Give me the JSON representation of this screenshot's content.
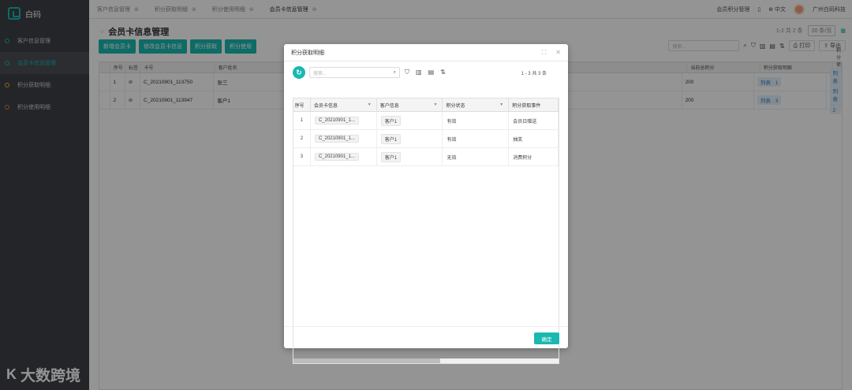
{
  "app": {
    "name": "白码",
    "brand_color": "#19b8b0"
  },
  "sidebar": {
    "items": [
      {
        "label": "客户信息管理"
      },
      {
        "label": "会员卡信息管理"
      },
      {
        "label": "积分获取明细"
      },
      {
        "label": "积分使用明细"
      }
    ]
  },
  "watermark": {
    "mark": "K",
    "text": "大数跨境"
  },
  "tabs": [
    {
      "label": "客户信息管理"
    },
    {
      "label": "积分获取明细"
    },
    {
      "label": "积分使用明细"
    },
    {
      "label": "会员卡信息管理"
    }
  ],
  "topbar": {
    "module": "会员积分管理",
    "lang": "中文",
    "org": "广州白码科技"
  },
  "page": {
    "title": "会员卡信息管理",
    "pager": "1-2 共 2 条",
    "page_size": "20 条/页",
    "buttons": [
      "新增会员卡",
      "修改会员卡信息",
      "积分获取",
      "积分使用"
    ],
    "search_placeholder": "搜索...",
    "print_label": "打印",
    "export_label": "导出"
  },
  "grid": {
    "columns": [
      "序号",
      "标签",
      "卡号",
      "客户姓名",
      "当前总积分",
      "积分获取明细",
      "积分使用明细"
    ],
    "rows": [
      {
        "no": "1",
        "card": "C_20210901_113750",
        "name": "张三",
        "points": "200",
        "gain": "列表 · 1",
        "use": "列表 · 1"
      },
      {
        "no": "2",
        "card": "C_20210901_113947",
        "name": "客户1",
        "points": "200",
        "gain": "列表 · 3",
        "use": "列表 · 2"
      }
    ]
  },
  "modal": {
    "title": "积分获取明细",
    "search_placeholder": "搜索...",
    "count": "1 - 3 共 3 条",
    "ok_label": "确定",
    "columns": [
      "序号",
      "会员卡信息",
      "客户信息",
      "积分状态",
      "积分获取事件"
    ],
    "rows": [
      {
        "no": "1",
        "card": "C_20210901_1...",
        "customer": "客户1",
        "status": "有效",
        "event": "会员日赠送"
      },
      {
        "no": "2",
        "card": "C_20210901_1...",
        "customer": "客户1",
        "status": "有效",
        "event": "抽奖"
      },
      {
        "no": "3",
        "card": "C_20210901_1...",
        "customer": "客户1",
        "status": "无效",
        "event": "消费积分"
      }
    ]
  }
}
